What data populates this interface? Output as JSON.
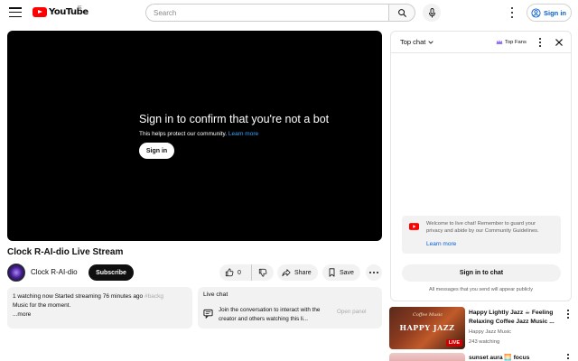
{
  "header": {
    "logo_text": "YouTube",
    "logo_region": "IE",
    "search_placeholder": "Search",
    "signin_label": "Sign in"
  },
  "player": {
    "bot_title": "Sign in to confirm that you're not a bot",
    "bot_subtitle": "This helps protect our community.",
    "bot_link": "Learn more",
    "bot_signin": "Sign in"
  },
  "video": {
    "title": "Clock R-AI-dio Live Stream",
    "channel_name": "Clock R-AI-dio",
    "subscribe_label": "Subscribe",
    "like_count": "0",
    "share_label": "Share",
    "save_label": "Save"
  },
  "description": {
    "stats": "1 watching now  Started streaming 76 minutes ago",
    "tag": "#backg",
    "text": "Music for the moment.",
    "more_label": "...more"
  },
  "livechat_card": {
    "title": "Live chat",
    "message": "Join the conversation to interact with the creator and others watching this li...",
    "open_panel": "Open panel"
  },
  "chat_panel": {
    "top_chat_label": "Top chat",
    "top_fans_label": "Top Fans",
    "welcome_text": "Welcome to live chat! Remember to guard your privacy and abide by our Community Guidelines.",
    "welcome_link": "Learn more",
    "signin_button": "Sign in to chat",
    "note": "All messages that you send will appear publicly"
  },
  "recommendations": [
    {
      "title": "Happy Lightly Jazz ☕ Feeling Relaxing Coffee Jazz Music ...",
      "channel": "Happy Jazz Music",
      "views": "243 watching",
      "thumb_caption": "HAPPY JAZZ",
      "thumb_subcaption": "Coffee Music",
      "badge": "LIVE"
    },
    {
      "title": "sunset aura 🌅 focus"
    }
  ]
}
